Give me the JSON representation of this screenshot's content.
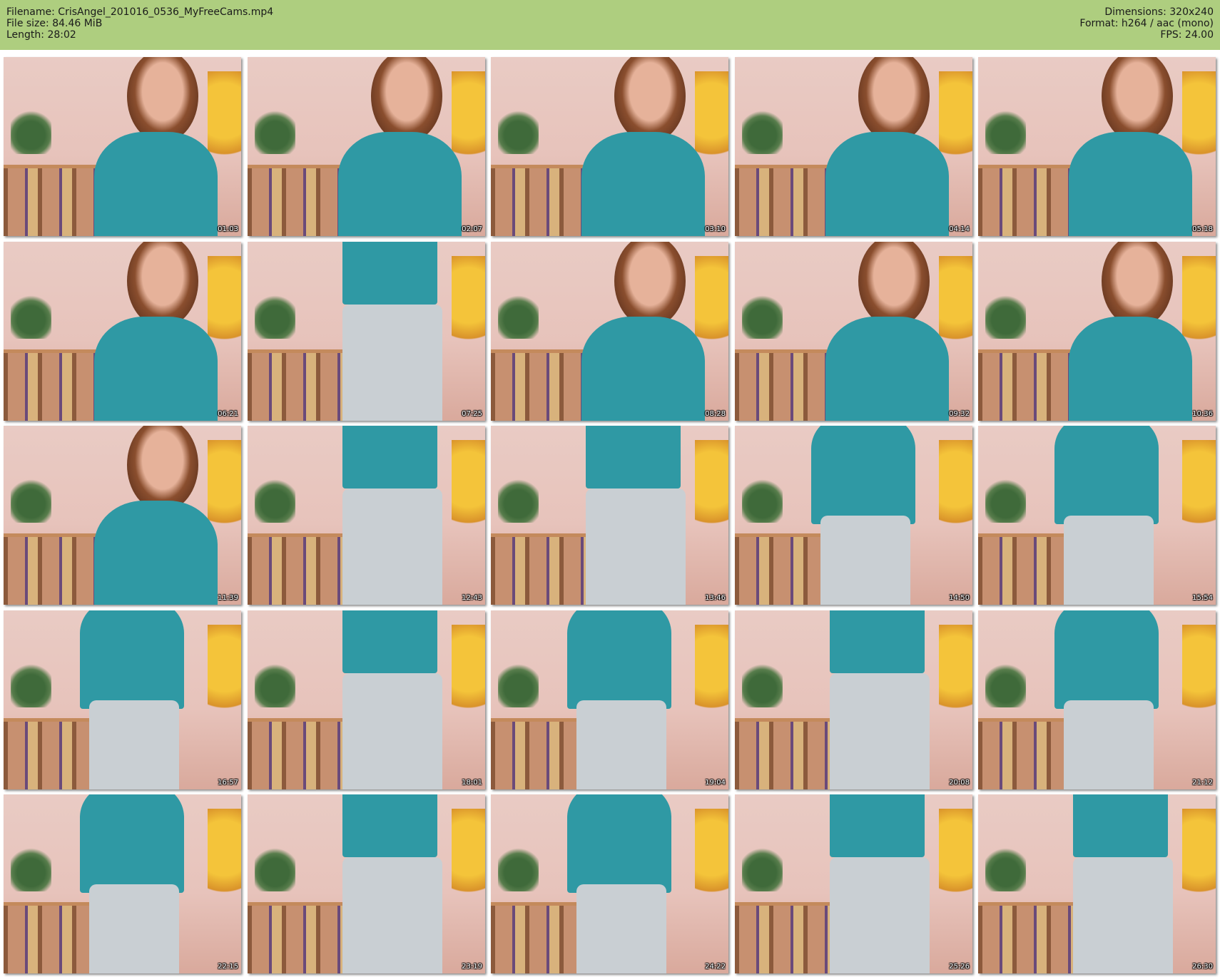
{
  "header": {
    "filename_label": "Filename: CrisAngel_201016_0536_MyFreeCams.mp4",
    "filesize_label": "File size: 84.46 MiB",
    "length_label": "Length: 28:02",
    "dimensions_label": "Dimensions: 320x240",
    "format_label": "Format: h264 / aac (mono)",
    "fps_label": "FPS: 24.00"
  },
  "colors": {
    "header_bg": "#aece7f",
    "shirt": "#2f99a4",
    "pants": "#c9cfd3"
  },
  "thumbnails": [
    {
      "timestamp": "01:03"
    },
    {
      "timestamp": "02:07"
    },
    {
      "timestamp": "03:10"
    },
    {
      "timestamp": "04:14"
    },
    {
      "timestamp": "05:18"
    },
    {
      "timestamp": "06:21"
    },
    {
      "timestamp": "07:25"
    },
    {
      "timestamp": "08:28"
    },
    {
      "timestamp": "09:32"
    },
    {
      "timestamp": "10:36"
    },
    {
      "timestamp": "11:39"
    },
    {
      "timestamp": "12:43"
    },
    {
      "timestamp": "13:46"
    },
    {
      "timestamp": "14:50"
    },
    {
      "timestamp": "15:54"
    },
    {
      "timestamp": "16:57"
    },
    {
      "timestamp": "18:01"
    },
    {
      "timestamp": "19:04"
    },
    {
      "timestamp": "20:08"
    },
    {
      "timestamp": "21:12"
    },
    {
      "timestamp": "22:15"
    },
    {
      "timestamp": "23:19"
    },
    {
      "timestamp": "24:22"
    },
    {
      "timestamp": "25:26"
    },
    {
      "timestamp": "26:30"
    }
  ]
}
